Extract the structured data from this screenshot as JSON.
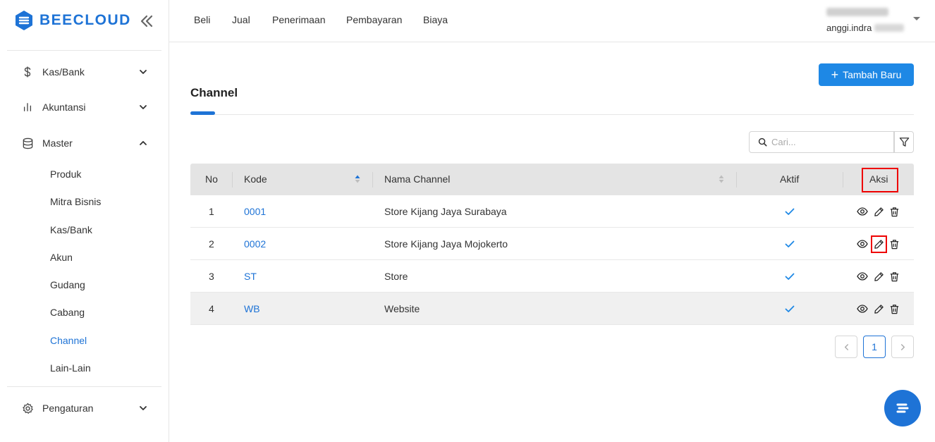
{
  "brand": {
    "name": "BEECLOUD"
  },
  "sidebar": {
    "menu": [
      {
        "label": "Kas/Bank",
        "icon": "dollar-icon",
        "expanded": false
      },
      {
        "label": "Akuntansi",
        "icon": "bar-chart-icon",
        "expanded": false
      },
      {
        "label": "Master",
        "icon": "database-icon",
        "expanded": true
      },
      {
        "label": "Pengaturan",
        "icon": "gear-icon",
        "expanded": false
      }
    ],
    "master_items": [
      "Produk",
      "Mitra Bisnis",
      "Kas/Bank",
      "Akun",
      "Gudang",
      "Cabang",
      "Channel",
      "Lain-Lain"
    ],
    "active_item": "Channel"
  },
  "topnav": {
    "links": [
      "Beli",
      "Jual",
      "Penerimaan",
      "Pembayaran",
      "Biaya"
    ],
    "user_email_prefix": "anggi.indra"
  },
  "page": {
    "title": "Channel",
    "add_button": "Tambah Baru",
    "search_placeholder": "Cari..."
  },
  "table": {
    "columns": [
      "No",
      "Kode",
      "Nama Channel",
      "Aktif",
      "Aksi"
    ],
    "rows": [
      {
        "no": "1",
        "kode": "0001",
        "nama": "Store Kijang Jaya Surabaya",
        "aktif": true
      },
      {
        "no": "2",
        "kode": "0002",
        "nama": "Store Kijang Jaya Mojokerto",
        "aktif": true
      },
      {
        "no": "3",
        "kode": "ST",
        "nama": "Store",
        "aktif": true
      },
      {
        "no": "4",
        "kode": "WB",
        "nama": "Website",
        "aktif": true
      }
    ]
  },
  "pagination": {
    "current": "1"
  },
  "colors": {
    "accent": "#1e73d6",
    "button": "#1e88e5",
    "highlight": "#e00000"
  }
}
